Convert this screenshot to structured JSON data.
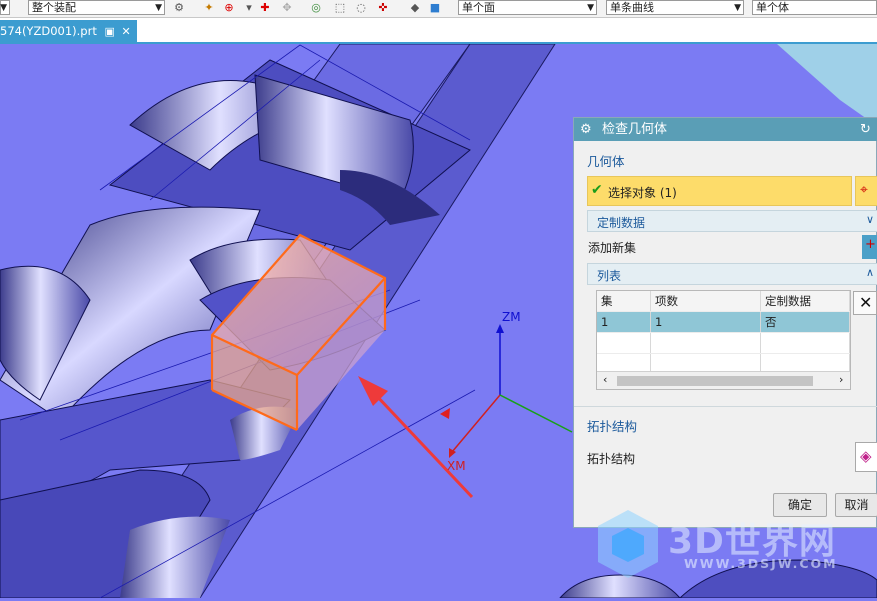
{
  "toolbar": {
    "assembly_filter": "整个装配",
    "face_rule": "单个面",
    "curve_rule": "单条曲线",
    "body_rule": "单个体"
  },
  "tab": {
    "filename": "574(YZD001).prt"
  },
  "viewport": {
    "triad": {
      "zm": "ZM",
      "xm": "XM"
    }
  },
  "dialog": {
    "title": "检查几何体",
    "geometry_section": "几何体",
    "select_object": "选择对象 (1)",
    "custom_data": "定制数据",
    "add_new_set": "添加新集",
    "list_section": "列表",
    "table": {
      "headers": [
        "集",
        "项数",
        "定制数据"
      ],
      "rows": [
        [
          "1",
          "1",
          "否"
        ]
      ]
    },
    "topology_section": "拓扑结构",
    "topology_label": "拓扑结构",
    "ok": "确定",
    "cancel": "取消"
  },
  "watermark": {
    "brand": "3D世界网",
    "url": "WWW.3DSJW.COM"
  },
  "colors": {
    "background": "#7b7bf3",
    "dialog_title": "#5a9eb6",
    "selection": "#fddc6a",
    "row_selected": "#8fc6d6",
    "box": "#ff6a1a"
  }
}
